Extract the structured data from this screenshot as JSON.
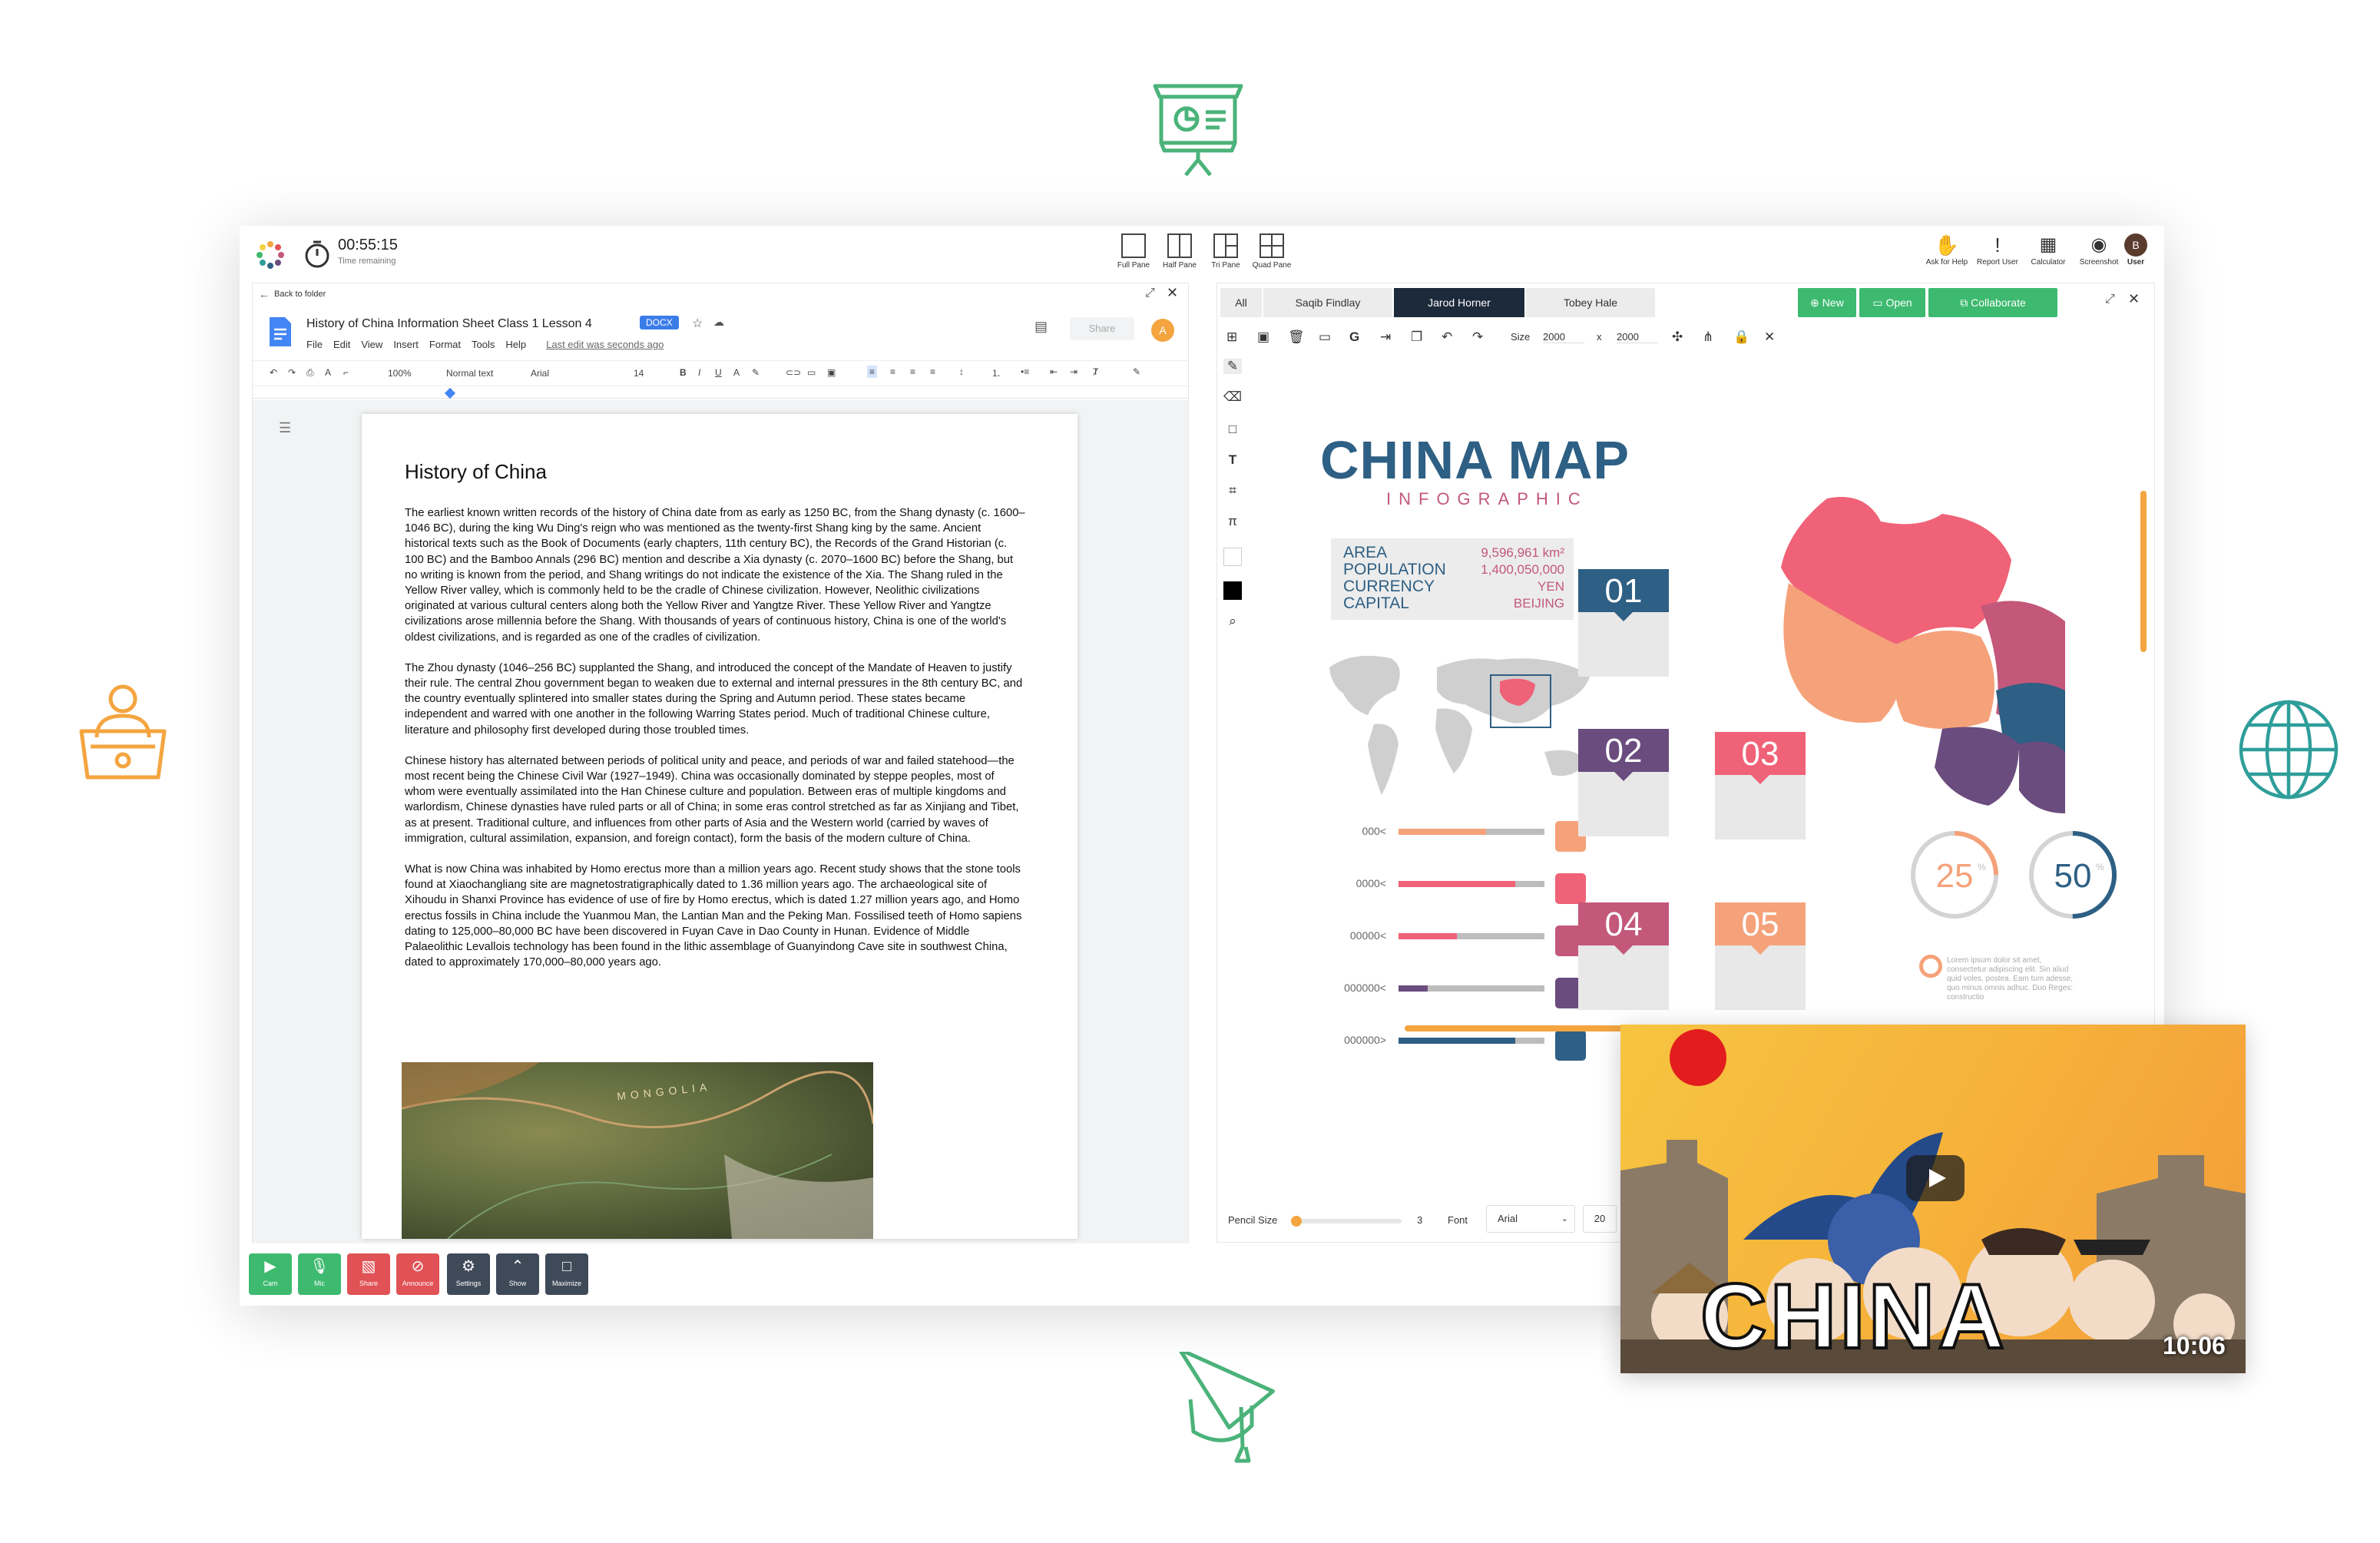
{
  "timer": {
    "time": "00:55:15",
    "label": "Time remaining"
  },
  "layouts": [
    {
      "label": "Full Pane"
    },
    {
      "label": "Half Pane"
    },
    {
      "label": "Tri Pane"
    },
    {
      "label": "Quad Pane"
    }
  ],
  "right_tools": [
    {
      "label": "Ask for Help"
    },
    {
      "label": "Report User"
    },
    {
      "label": "Calculator"
    },
    {
      "label": "Screenshot"
    },
    {
      "label": "User"
    }
  ],
  "user_avatar_letter": "B",
  "doc": {
    "back_label": "Back to folder",
    "title": "History of China Information Sheet Class 1 Lesson 4",
    "badge": "DOCX",
    "menu": [
      "File",
      "Edit",
      "View",
      "Insert",
      "Format",
      "Tools",
      "Help"
    ],
    "last_edit": "Last edit was seconds ago",
    "share_label": "Share",
    "avatar_letter": "A",
    "zoom": "100%",
    "style": "Normal text",
    "font": "Arial",
    "font_size": "14",
    "heading": "History of China",
    "paragraphs": [
      "The earliest known written records of the history of China date from as early as 1250 BC, from the Shang dynasty (c. 1600–1046 BC), during the king Wu Ding's reign who was mentioned as the twenty-first Shang king by the same. Ancient historical texts such as the Book of Documents (early chapters, 11th century BC), the Records of the Grand Historian (c. 100 BC) and the Bamboo Annals (296 BC) mention and describe a Xia dynasty (c. 2070–1600 BC) before the Shang, but no writing is known from the period, and Shang writings do not indicate the existence of the Xia. The Shang ruled in the Yellow River valley, which is commonly held to be the cradle of Chinese civilization. However, Neolithic civilizations originated at various cultural centers along both the Yellow River and Yangtze River. These Yellow River and Yangtze civilizations arose millennia before the Shang. With thousands of years of continuous history, China is one of the world's oldest civilizations, and is regarded as one of the cradles of civilization.",
      "The Zhou dynasty (1046–256 BC) supplanted the Shang, and introduced the concept of the Mandate of Heaven to justify their rule. The central Zhou government began to weaken due to external and internal pressures in the 8th century BC, and the country eventually splintered into smaller states during the Spring and Autumn period. These states became independent and warred with one another in the following Warring States period. Much of traditional Chinese culture, literature and philosophy first developed during those troubled times.",
      "Chinese history has alternated between periods of political unity and peace, and periods of war and failed statehood—the most recent being the Chinese Civil War (1927–1949). China was occasionally dominated by steppe peoples, most of whom were eventually assimilated into the Han Chinese culture and population. Between eras of multiple kingdoms and warlordism, Chinese dynasties have ruled parts or all of China; in some eras control stretched as far as Xinjiang and Tibet, as at present. Traditional culture, and influences from other parts of Asia and the Western world (carried by waves of immigration, cultural assimilation, expansion, and foreign contact), form the basis of the modern culture of China.",
      "What is now China was inhabited by Homo erectus more than a million years ago. Recent study shows that the stone tools found at Xiaochangliang site are magnetostratigraphically dated to 1.36 million years ago. The archaeological site of Xihoudu in Shanxi Province has evidence of use of fire by Homo erectus, which is dated 1.27 million years ago, and Homo erectus fossils in China include the Yuanmou Man, the Lantian Man and the Peking Man. Fossilised teeth of Homo sapiens dating to 125,000–80,000 BC have been discovered in Fuyan Cave in Dao County in Hunan. Evidence of Middle Palaeolithic Levallois technology has been found in the lithic assemblage of Guanyindong Cave site in southwest China, dated to approximately 170,000–80,000 years ago."
    ],
    "map_label": "MONGOLIA"
  },
  "whiteboard": {
    "tabs": [
      "All",
      "Saqib Findlay",
      "Jarod Horner",
      "Tobey Hale"
    ],
    "active_tab": "Jarod Horner",
    "buttons": {
      "new": "New",
      "open": "Open",
      "collaborate": "Collaborate"
    },
    "size_label": "Size",
    "width": "2000",
    "x_label": "x",
    "height": "2000",
    "pencil_label": "Pencil Size",
    "pencil_value": "3",
    "font_label": "Font",
    "font_value": "Arial",
    "font_size": "20",
    "infographic": {
      "title": "CHINA MAP",
      "subtitle": "INFOGRAPHIC",
      "facts": [
        {
          "key": "AREA",
          "value": "9,596,961 km²"
        },
        {
          "key": "POPULATION",
          "value": "1,400,050,000"
        },
        {
          "key": "CURRENCY",
          "value": "YEN"
        },
        {
          "key": "CAPITAL",
          "value": "BEIJING"
        }
      ],
      "cards": [
        {
          "num": "01",
          "color": "#2e5f84"
        },
        {
          "num": "02",
          "color": "#6b4c7e"
        },
        {
          "num": "03",
          "color": "#f06277"
        },
        {
          "num": "04",
          "color": "#c3587a"
        },
        {
          "num": "05",
          "color": "#f5a27a"
        }
      ],
      "bars": [
        {
          "label": "000<",
          "value": 0.6,
          "color": "#f5a27a"
        },
        {
          "label": "0000<",
          "value": 0.8,
          "color": "#f06277"
        },
        {
          "label": "00000<",
          "value": 0.4,
          "color": "#f06277"
        },
        {
          "label": "000000<",
          "value": 0.2,
          "color": "#6b4c7e"
        },
        {
          "label": "000000>",
          "value": 0.8,
          "color": "#2e5f84"
        }
      ],
      "bar_swatches": [
        "#f5a27a",
        "#f06277",
        "#c3587a",
        "#6b4c7e",
        "#2e5f84"
      ],
      "gauges": [
        {
          "value": "25",
          "pct": 0.25,
          "color": "#f5a27a"
        },
        {
          "value": "50",
          "pct": 0.5,
          "color": "#2e5f84"
        }
      ],
      "lorem": "Lorem ipsum dolor sit amet, consectetur adipiscing elit. Sin aliud quid voles, postea. Eam tum adesse, quo minus omnis adhuc. Duo Reges: constructio"
    }
  },
  "bottom_controls": [
    {
      "label": "Cam",
      "color": "#3dba6f",
      "icon": "camera-icon"
    },
    {
      "label": "Mic",
      "color": "#3dba6f",
      "icon": "mic-icon"
    },
    {
      "label": "Share",
      "color": "#e05255",
      "icon": "share-icon"
    },
    {
      "label": "Announce",
      "color": "#e05255",
      "icon": "announce-icon"
    },
    {
      "label": "Settings",
      "color": "#3f4a59",
      "icon": "gear-icon"
    },
    {
      "label": "Show",
      "color": "#3f4a59",
      "icon": "chevron-up-icon"
    },
    {
      "label": "Maximize",
      "color": "#3f4a59",
      "icon": "maximize-icon"
    }
  ],
  "video": {
    "title": "CHINA",
    "duration": "10:06"
  }
}
